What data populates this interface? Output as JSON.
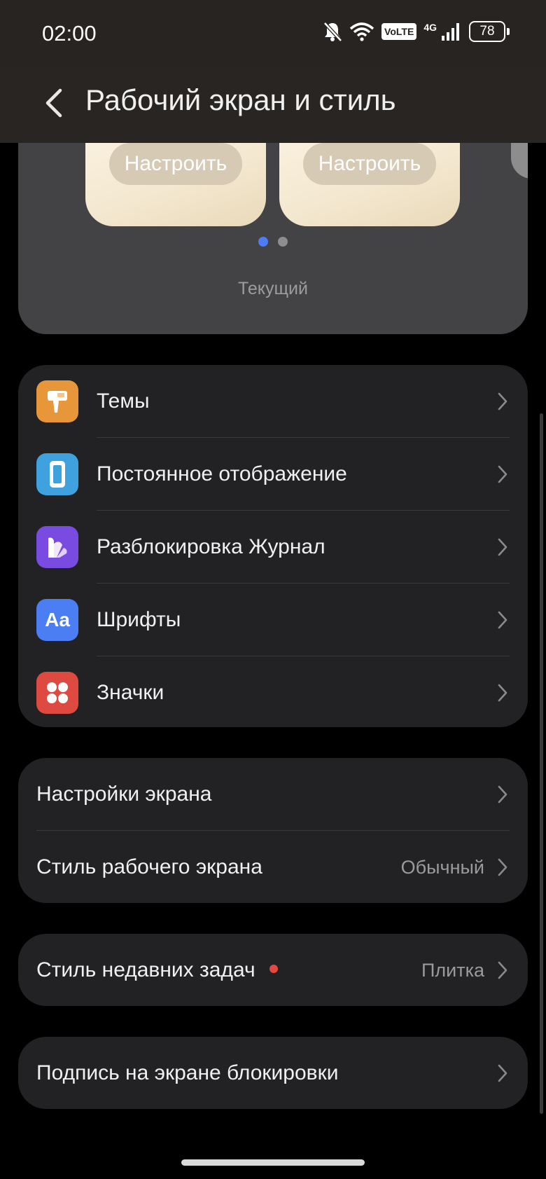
{
  "status_bar": {
    "time": "02:00",
    "volte": "VoLTE",
    "network": "4G",
    "battery": "78",
    "icons": [
      "bell-muted-icon",
      "wifi-icon",
      "volte-icon",
      "signal-icon",
      "battery-icon"
    ]
  },
  "header": {
    "title": "Рабочий экран и стиль",
    "back_icon": "chevron-left-icon"
  },
  "preview": {
    "customize_label_1": "Настроить",
    "customize_label_2": "Настроить",
    "current_label": "Текущий",
    "page_count": 2,
    "active_page": 1
  },
  "personalization": {
    "items": [
      {
        "label": "Темы",
        "icon": "themes-brush-icon",
        "icon_color": "#E8963A"
      },
      {
        "label": "Постоянное отображение",
        "icon": "always-on-display-icon",
        "icon_color": "#3FA2DE"
      },
      {
        "label": "Разблокировка Журнал",
        "icon": "unlock-magazine-icon",
        "icon_color": "#7A4BE0"
      },
      {
        "label": "Шрифты",
        "icon": "fonts-icon",
        "icon_text": "Aa",
        "icon_color": "#4C7EF3"
      },
      {
        "label": "Значки",
        "icon": "icons-grid-icon",
        "icon_color": "#DE4A40"
      }
    ]
  },
  "screen": {
    "settings_label": "Настройки экрана",
    "home_style_label": "Стиль рабочего экрана",
    "home_style_value": "Обычный"
  },
  "recents": {
    "label": "Стиль недавних задач",
    "value": "Плитка",
    "badge_color": "#E5483E"
  },
  "lock_signature": {
    "label": "Подпись на экране блокировки"
  }
}
